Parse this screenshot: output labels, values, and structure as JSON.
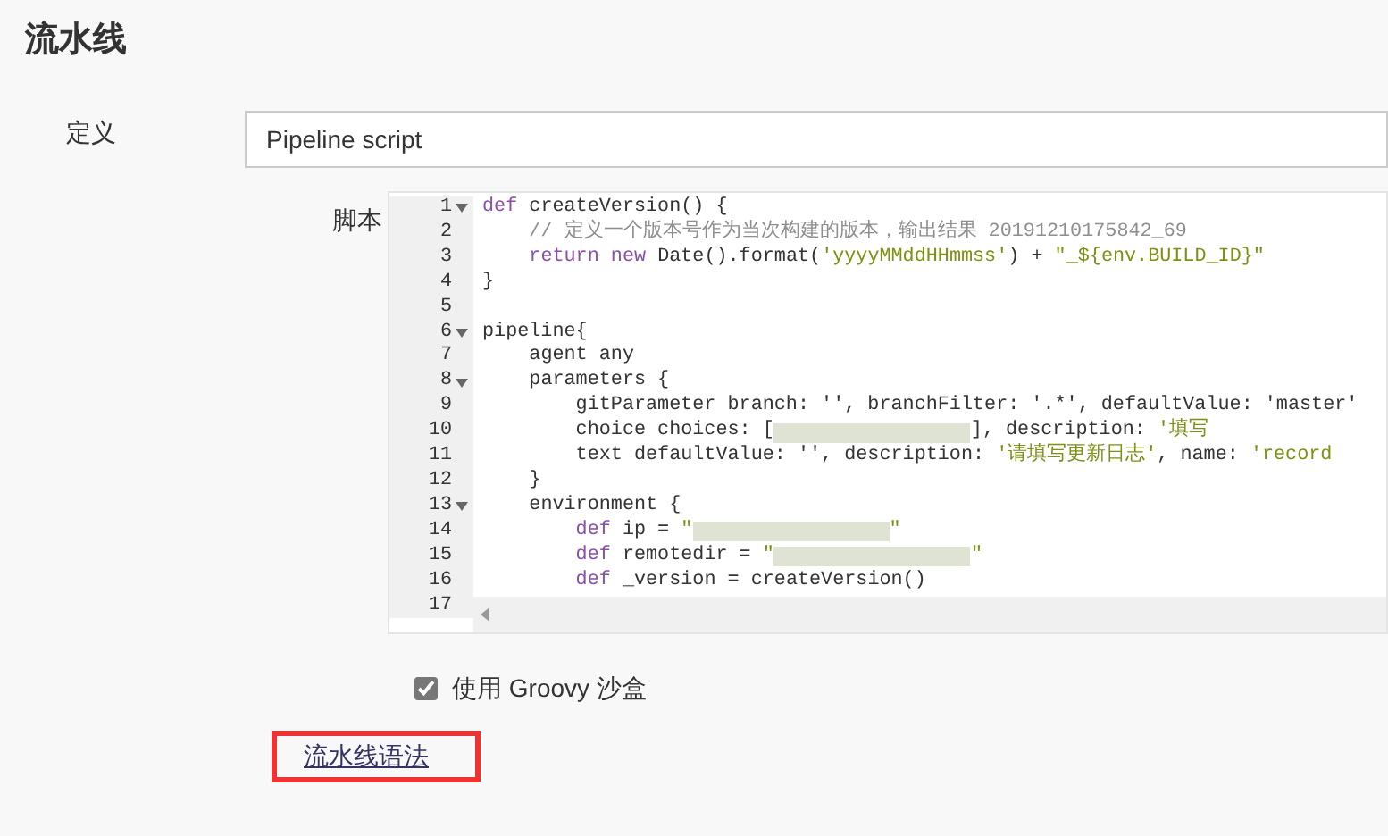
{
  "section_title": "流水线",
  "definition": {
    "label": "定义",
    "value": "Pipeline script"
  },
  "script": {
    "label": "脚本",
    "lines": [
      {
        "number": "1",
        "foldable": true,
        "tokens": [
          {
            "kind": "kw",
            "text": "def"
          },
          {
            "kind": "plain",
            "text": " createVersion() {"
          }
        ]
      },
      {
        "number": "2",
        "foldable": false,
        "tokens": [
          {
            "kind": "comment",
            "text": "    // 定义一个版本号作为当次构建的版本，输出结果 20191210175842_69"
          }
        ]
      },
      {
        "number": "3",
        "foldable": false,
        "tokens": [
          {
            "kind": "kw",
            "text": "    return new"
          },
          {
            "kind": "plain",
            "text": " Date().format("
          },
          {
            "kind": "str",
            "text": "'yyyyMMddHHmmss'"
          },
          {
            "kind": "plain",
            "text": ") + "
          },
          {
            "kind": "str",
            "text": "\"_${env.BUILD_ID}\""
          }
        ]
      },
      {
        "number": "4",
        "foldable": false,
        "tokens": [
          {
            "kind": "plain",
            "text": "}"
          }
        ]
      },
      {
        "number": "5",
        "foldable": false
      },
      {
        "number": "6",
        "foldable": true,
        "tokens": [
          {
            "kind": "plain",
            "text": "pipeline{"
          }
        ]
      },
      {
        "number": "7",
        "foldable": false,
        "tokens": [
          {
            "kind": "plain",
            "text": "    agent any"
          }
        ]
      },
      {
        "number": "8",
        "foldable": true,
        "tokens": [
          {
            "kind": "plain",
            "text": "    parameters {"
          }
        ]
      },
      {
        "number": "9",
        "foldable": false,
        "tokens": [
          {
            "kind": "plain",
            "text": "        gitParameter branch: '', branchFilter: '.*', defaultValue: 'master'"
          }
        ]
      },
      {
        "number": "10",
        "foldable": false,
        "tokens": [
          {
            "kind": "plain",
            "text": "        choice choices: ["
          },
          {
            "kind": "redacted"
          },
          {
            "kind": "plain",
            "text": "], description: "
          },
          {
            "kind": "str",
            "text": "'填写"
          }
        ]
      },
      {
        "number": "11",
        "foldable": false,
        "tokens": [
          {
            "kind": "plain",
            "text": "        text defaultValue: '', description: "
          },
          {
            "kind": "str",
            "text": "'请填写更新日志'"
          },
          {
            "kind": "plain",
            "text": ", name: "
          },
          {
            "kind": "str",
            "text": "'record"
          }
        ]
      },
      {
        "number": "12",
        "foldable": false,
        "tokens": [
          {
            "kind": "plain",
            "text": "    }"
          }
        ]
      },
      {
        "number": "13",
        "foldable": true,
        "tokens": [
          {
            "kind": "plain",
            "text": "    environment {"
          }
        ]
      },
      {
        "number": "14",
        "foldable": false,
        "tokens": [
          {
            "kind": "kw",
            "text": "        def"
          },
          {
            "kind": "plain",
            "text": " ip = "
          },
          {
            "kind": "str",
            "text": "\""
          },
          {
            "kind": "redacted"
          },
          {
            "kind": "str",
            "text": "\""
          }
        ]
      },
      {
        "number": "15",
        "foldable": false,
        "tokens": [
          {
            "kind": "kw",
            "text": "        def"
          },
          {
            "kind": "plain",
            "text": " remotedir = "
          },
          {
            "kind": "str",
            "text": "\""
          },
          {
            "kind": "redacted"
          },
          {
            "kind": "str",
            "text": "\""
          }
        ]
      },
      {
        "number": "16",
        "foldable": false,
        "tokens": [
          {
            "kind": "kw",
            "text": "        def"
          },
          {
            "kind": "plain",
            "text": " _version = createVersion()"
          }
        ]
      },
      {
        "number": "17",
        "foldable": false
      }
    ]
  },
  "sandbox": {
    "label": "使用 Groovy 沙盒",
    "checked": true
  },
  "syntax_link": {
    "text": "流水线语法",
    "highlighted": true
  }
}
